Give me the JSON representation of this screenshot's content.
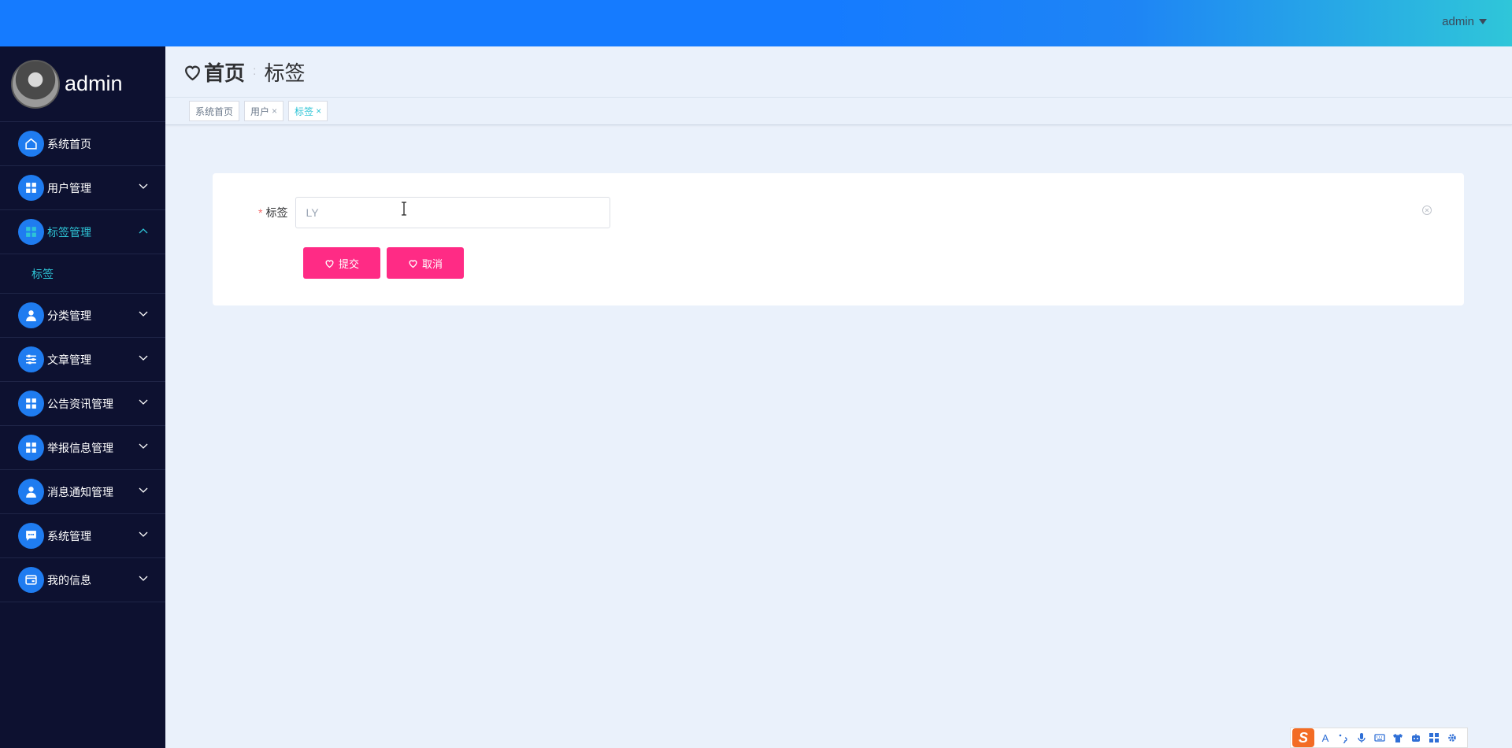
{
  "topbar": {
    "user_label": "admin"
  },
  "sidebar": {
    "profile_name": "admin",
    "items": [
      {
        "label": "系统首页",
        "icon": "home-icon",
        "has_chevron": false
      },
      {
        "label": "用户管理",
        "icon": "grid-icon",
        "has_chevron": true
      },
      {
        "label": "标签管理",
        "icon": "grid-icon",
        "has_chevron": true,
        "expanded": true
      },
      {
        "label": "分类管理",
        "icon": "user-icon",
        "has_chevron": true
      },
      {
        "label": "文章管理",
        "icon": "sliders-icon",
        "has_chevron": true
      },
      {
        "label": "公告资讯管理",
        "icon": "grid-icon",
        "has_chevron": true
      },
      {
        "label": "举报信息管理",
        "icon": "grid-icon",
        "has_chevron": true
      },
      {
        "label": "消息通知管理",
        "icon": "user-icon",
        "has_chevron": true
      },
      {
        "label": "系统管理",
        "icon": "chat-icon",
        "has_chevron": true
      },
      {
        "label": "我的信息",
        "icon": "wallet-icon",
        "has_chevron": true
      }
    ],
    "submenu": {
      "label": "标签"
    }
  },
  "header": {
    "home": "首页",
    "current": "标签"
  },
  "tags": [
    {
      "label": "系统首页"
    },
    {
      "label": "用户",
      "close": "×"
    },
    {
      "label": "标签",
      "close": "×"
    }
  ],
  "form": {
    "required_mark": "*",
    "label": "标签",
    "input_value": "LY",
    "submit_label": "提交",
    "cancel_label": "取消"
  },
  "ime": {
    "logo": "S",
    "a": "A"
  },
  "colors": {
    "topbar": "#157bff",
    "sidebar": "#0d1130",
    "accent": "#2ec4d6",
    "button": "#ff2b85"
  }
}
